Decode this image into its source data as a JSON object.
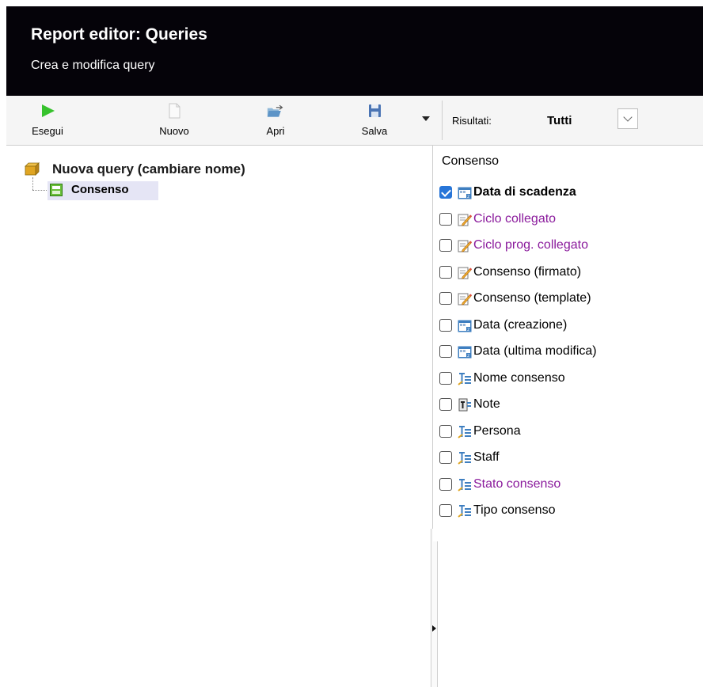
{
  "header": {
    "title": "Report editor: Queries",
    "subtitle": "Crea e modifica query"
  },
  "toolbar": {
    "run_label": "Esegui",
    "new_label": "Nuovo",
    "open_label": "Apri",
    "save_label": "Salva",
    "results_label": "Risultati:",
    "results_value": "Tutti"
  },
  "tree": {
    "root_label": "Nuova query (cambiare nome)",
    "child_label": "Consenso"
  },
  "fields_panel": {
    "title": "Consenso",
    "fields": [
      {
        "label": "Data di scadenza",
        "checked": true,
        "icon": "calendar-icon",
        "color": "#000000",
        "bold": true
      },
      {
        "label": "Ciclo collegato",
        "checked": false,
        "icon": "edit-link-icon",
        "color": "#8a1a9c",
        "bold": false
      },
      {
        "label": "Ciclo prog. collegato",
        "checked": false,
        "icon": "edit-link-icon",
        "color": "#8a1a9c",
        "bold": false
      },
      {
        "label": "Consenso (firmato)",
        "checked": false,
        "icon": "edit-link-icon",
        "color": "#000000",
        "bold": false
      },
      {
        "label": "Consenso (template)",
        "checked": false,
        "icon": "edit-link-icon",
        "color": "#000000",
        "bold": false
      },
      {
        "label": "Data (creazione)",
        "checked": false,
        "icon": "calendar-icon",
        "color": "#000000",
        "bold": false
      },
      {
        "label": "Data (ultima modifica)",
        "checked": false,
        "icon": "calendar-icon",
        "color": "#000000",
        "bold": false
      },
      {
        "label": "Nome consenso",
        "checked": false,
        "icon": "text-field-icon",
        "color": "#000000",
        "bold": false
      },
      {
        "label": "Note",
        "checked": false,
        "icon": "note-field-icon",
        "color": "#000000",
        "bold": false
      },
      {
        "label": "Persona",
        "checked": false,
        "icon": "text-field-icon",
        "color": "#000000",
        "bold": false
      },
      {
        "label": "Staff",
        "checked": false,
        "icon": "text-field-icon",
        "color": "#000000",
        "bold": false
      },
      {
        "label": "Stato consenso",
        "checked": false,
        "icon": "text-field-icon",
        "color": "#8a1a9c",
        "bold": false
      },
      {
        "label": "Tipo consenso",
        "checked": false,
        "icon": "text-field-icon",
        "color": "#000000",
        "bold": false
      }
    ]
  }
}
